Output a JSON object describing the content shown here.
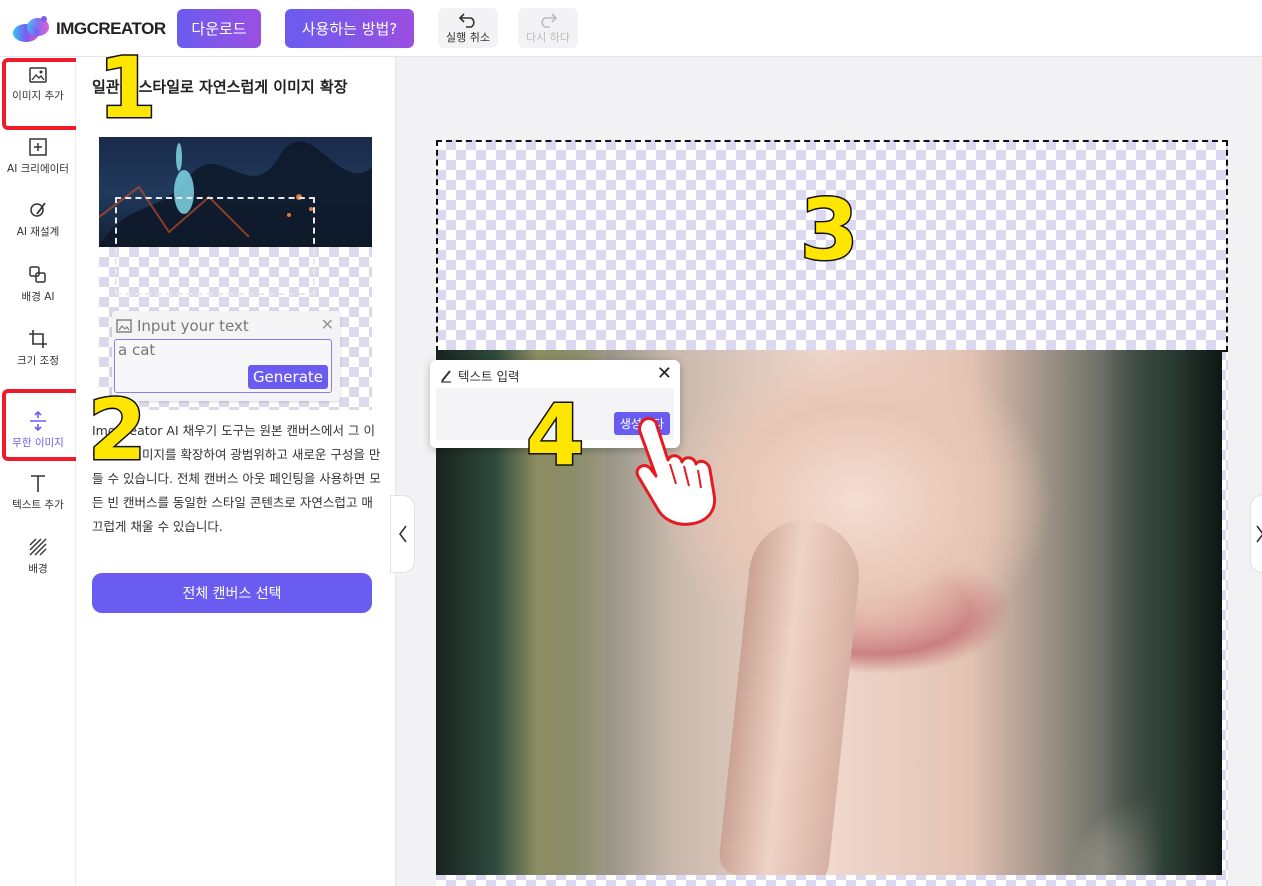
{
  "header": {
    "logo_text": "IMGCREATOR",
    "download_label": "다운로드",
    "howto_label": "사용하는 방법?",
    "undo_label": "실행 취소",
    "redo_label": "다시 하다"
  },
  "sidebar": {
    "items": [
      {
        "label": "이미지 추가",
        "icon": "image-add-icon"
      },
      {
        "label": "AI 크리에이터",
        "icon": "plus-square-icon"
      },
      {
        "label": "AI 재설계",
        "icon": "brush-icon"
      },
      {
        "label": "배경 AI",
        "icon": "layers-icon"
      },
      {
        "label": "크기 조정",
        "icon": "crop-icon"
      },
      {
        "label": "무한 이미지",
        "icon": "expand-vertical-icon"
      },
      {
        "label": "텍스트 추가",
        "icon": "text-icon"
      },
      {
        "label": "배경",
        "icon": "hatch-icon"
      }
    ]
  },
  "panel": {
    "title": "일관된 스타일로 자연스럽게 이미지 확장",
    "preview": {
      "input_header": "Input your text",
      "input_value": "a cat",
      "generate_label": "Generate"
    },
    "description": "ImgCreator AI 채우기 도구는 원본 캔버스에서 그 이상으로 이미지를 확장하여 광범위하고 새로운 구성을 만들 수 있습니다. 전체 캔버스 아웃 페인팅을 사용하면 모든 빈 캔버스를 동일한 스타일 콘텐츠로 자연스럽고 매끄럽게 채울 수 있습니다.",
    "select_all_label": "전체 캔버스 선택"
  },
  "popover": {
    "title": "텍스트 입력",
    "generate_label": "생성하다"
  },
  "annotations": [
    "1",
    "2",
    "3",
    "4"
  ],
  "colors": {
    "accent": "#6a5cf0",
    "highlight_box": "#ef1b2a",
    "annotation_number": "#ffe600"
  }
}
